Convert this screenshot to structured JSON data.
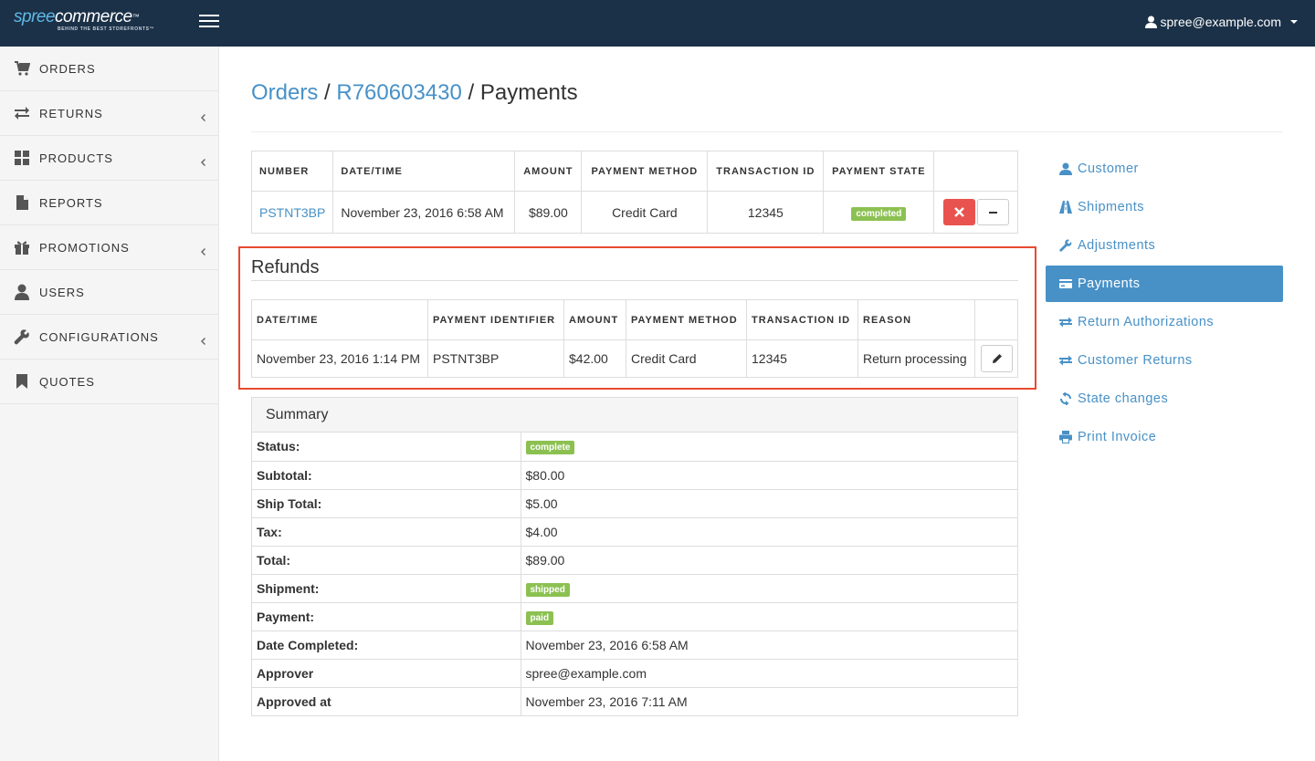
{
  "topbar": {
    "logo_spree": "spree",
    "logo_commerce": "commerce",
    "logo_tm": "™",
    "logo_tagline": "BEHIND THE BEST STOREFRONTS™",
    "user_email": "spree@example.com"
  },
  "sidebar": {
    "items": [
      {
        "label": "ORDERS",
        "icon": "cart-icon",
        "has_submenu": false
      },
      {
        "label": "RETURNS",
        "icon": "transfer-icon",
        "has_submenu": true
      },
      {
        "label": "PRODUCTS",
        "icon": "grid-icon",
        "has_submenu": true
      },
      {
        "label": "REPORTS",
        "icon": "file-icon",
        "has_submenu": false
      },
      {
        "label": "PROMOTIONS",
        "icon": "gift-icon",
        "has_submenu": true
      },
      {
        "label": "USERS",
        "icon": "user-icon",
        "has_submenu": false
      },
      {
        "label": "CONFIGURATIONS",
        "icon": "wrench-icon",
        "has_submenu": true
      },
      {
        "label": "QUOTES",
        "icon": "bookmark-icon",
        "has_submenu": false
      }
    ]
  },
  "breadcrumb": {
    "orders": "Orders",
    "sep1": " / ",
    "order_number": "R760603430",
    "sep2": " / ",
    "current": "Payments"
  },
  "payments": {
    "headers": [
      "NUMBER",
      "DATE/TIME",
      "AMOUNT",
      "PAYMENT METHOD",
      "TRANSACTION ID",
      "PAYMENT STATE"
    ],
    "row": {
      "number": "PSTNT3BP",
      "datetime": "November 23, 2016 6:58 AM",
      "amount": "$89.00",
      "method": "Credit Card",
      "transaction_id": "12345",
      "state": "completed"
    }
  },
  "refunds": {
    "title": "Refunds",
    "headers": [
      "DATE/TIME",
      "PAYMENT IDENTIFIER",
      "AMOUNT",
      "PAYMENT METHOD",
      "TRANSACTION ID",
      "REASON"
    ],
    "row": {
      "datetime": "November 23, 2016 1:14 PM",
      "identifier": "PSTNT3BP",
      "amount": "$42.00",
      "method": "Credit Card",
      "transaction_id": "12345",
      "reason": "Return processing"
    }
  },
  "summary": {
    "title": "Summary",
    "status_label": "Status:",
    "status": "complete",
    "subtotal_label": "Subtotal:",
    "subtotal": "$80.00",
    "ship_total_label": "Ship Total:",
    "ship_total": "$5.00",
    "tax_label": "Tax:",
    "tax": "$4.00",
    "total_label": "Total:",
    "total": "$89.00",
    "shipment_label": "Shipment:",
    "shipment": "shipped",
    "payment_label": "Payment:",
    "payment": "paid",
    "date_completed_label": "Date Completed:",
    "date_completed": "November 23, 2016 6:58 AM",
    "approver_label": "Approver",
    "approver": "spree@example.com",
    "approved_at_label": "Approved at",
    "approved_at": "November 23, 2016 7:11 AM"
  },
  "right_nav": {
    "items": [
      {
        "label": "Customer",
        "icon": "user-icon"
      },
      {
        "label": "Shipments",
        "icon": "road-icon"
      },
      {
        "label": "Adjustments",
        "icon": "wrench-icon"
      },
      {
        "label": "Payments",
        "icon": "credit-card-icon",
        "active": true
      },
      {
        "label": "Return Authorizations",
        "icon": "transfer-icon"
      },
      {
        "label": "Customer Returns",
        "icon": "transfer-icon"
      },
      {
        "label": "State changes",
        "icon": "refresh-icon"
      },
      {
        "label": "Print Invoice",
        "icon": "print-icon"
      }
    ]
  },
  "colors": {
    "topbar": "#1b3148",
    "link": "#4891c7",
    "badge_green": "#8cc152",
    "danger": "#e9534f",
    "highlight": "#e64a2e"
  }
}
